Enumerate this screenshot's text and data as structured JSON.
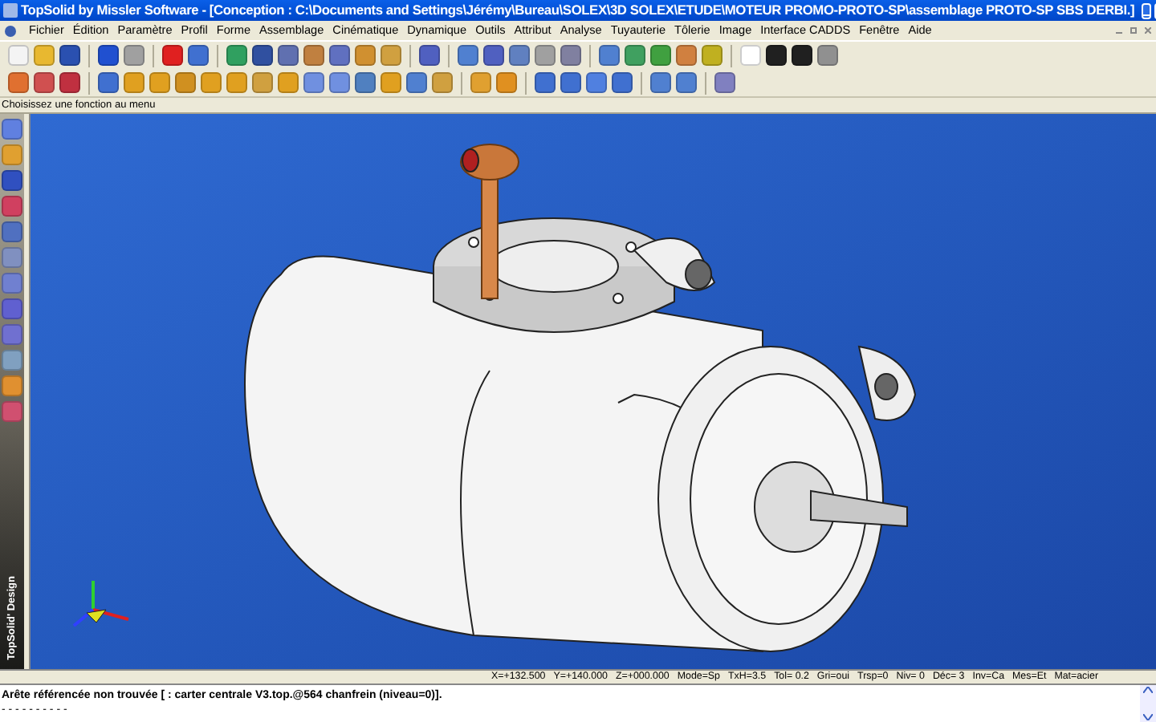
{
  "window": {
    "title": "TopSolid by Missler Software - [Conception : C:\\Documents and Settings\\Jérémy\\Bureau\\SOLEX\\3D SOLEX\\ETUDE\\MOTEUR PROMO-PROTO-SP\\assemblage PROTO-SP SBS DERBI.]"
  },
  "menu": [
    "Fichier",
    "Édition",
    "Paramètre",
    "Profil",
    "Forme",
    "Assemblage",
    "Cinématique",
    "Dynamique",
    "Outils",
    "Attribut",
    "Analyse",
    "Tuyauterie",
    "Tôlerie",
    "Image",
    "Interface CADDS",
    "Fenêtre",
    "Aide"
  ],
  "hint": "Choisissez une fonction au menu",
  "side_toolbar": {
    "label": "TopSolid' Design"
  },
  "status_bar": [
    "X=+132.500",
    "Y=+140.000",
    "Z=+000.000",
    "Mode=Sp",
    "TxH=3.5",
    "Tol= 0.2",
    "Gri=oui",
    "Trsp=0",
    "Niv= 0",
    "Déc= 3",
    "Inv=Ca",
    "Mes=Et",
    "Mat=acier"
  ],
  "messages": [
    "Arête référencée non trouvée [ : carter centrale V3.top.@564 chanfrein (niveau=0)].",
    "- - - - - - - - - -"
  ]
}
